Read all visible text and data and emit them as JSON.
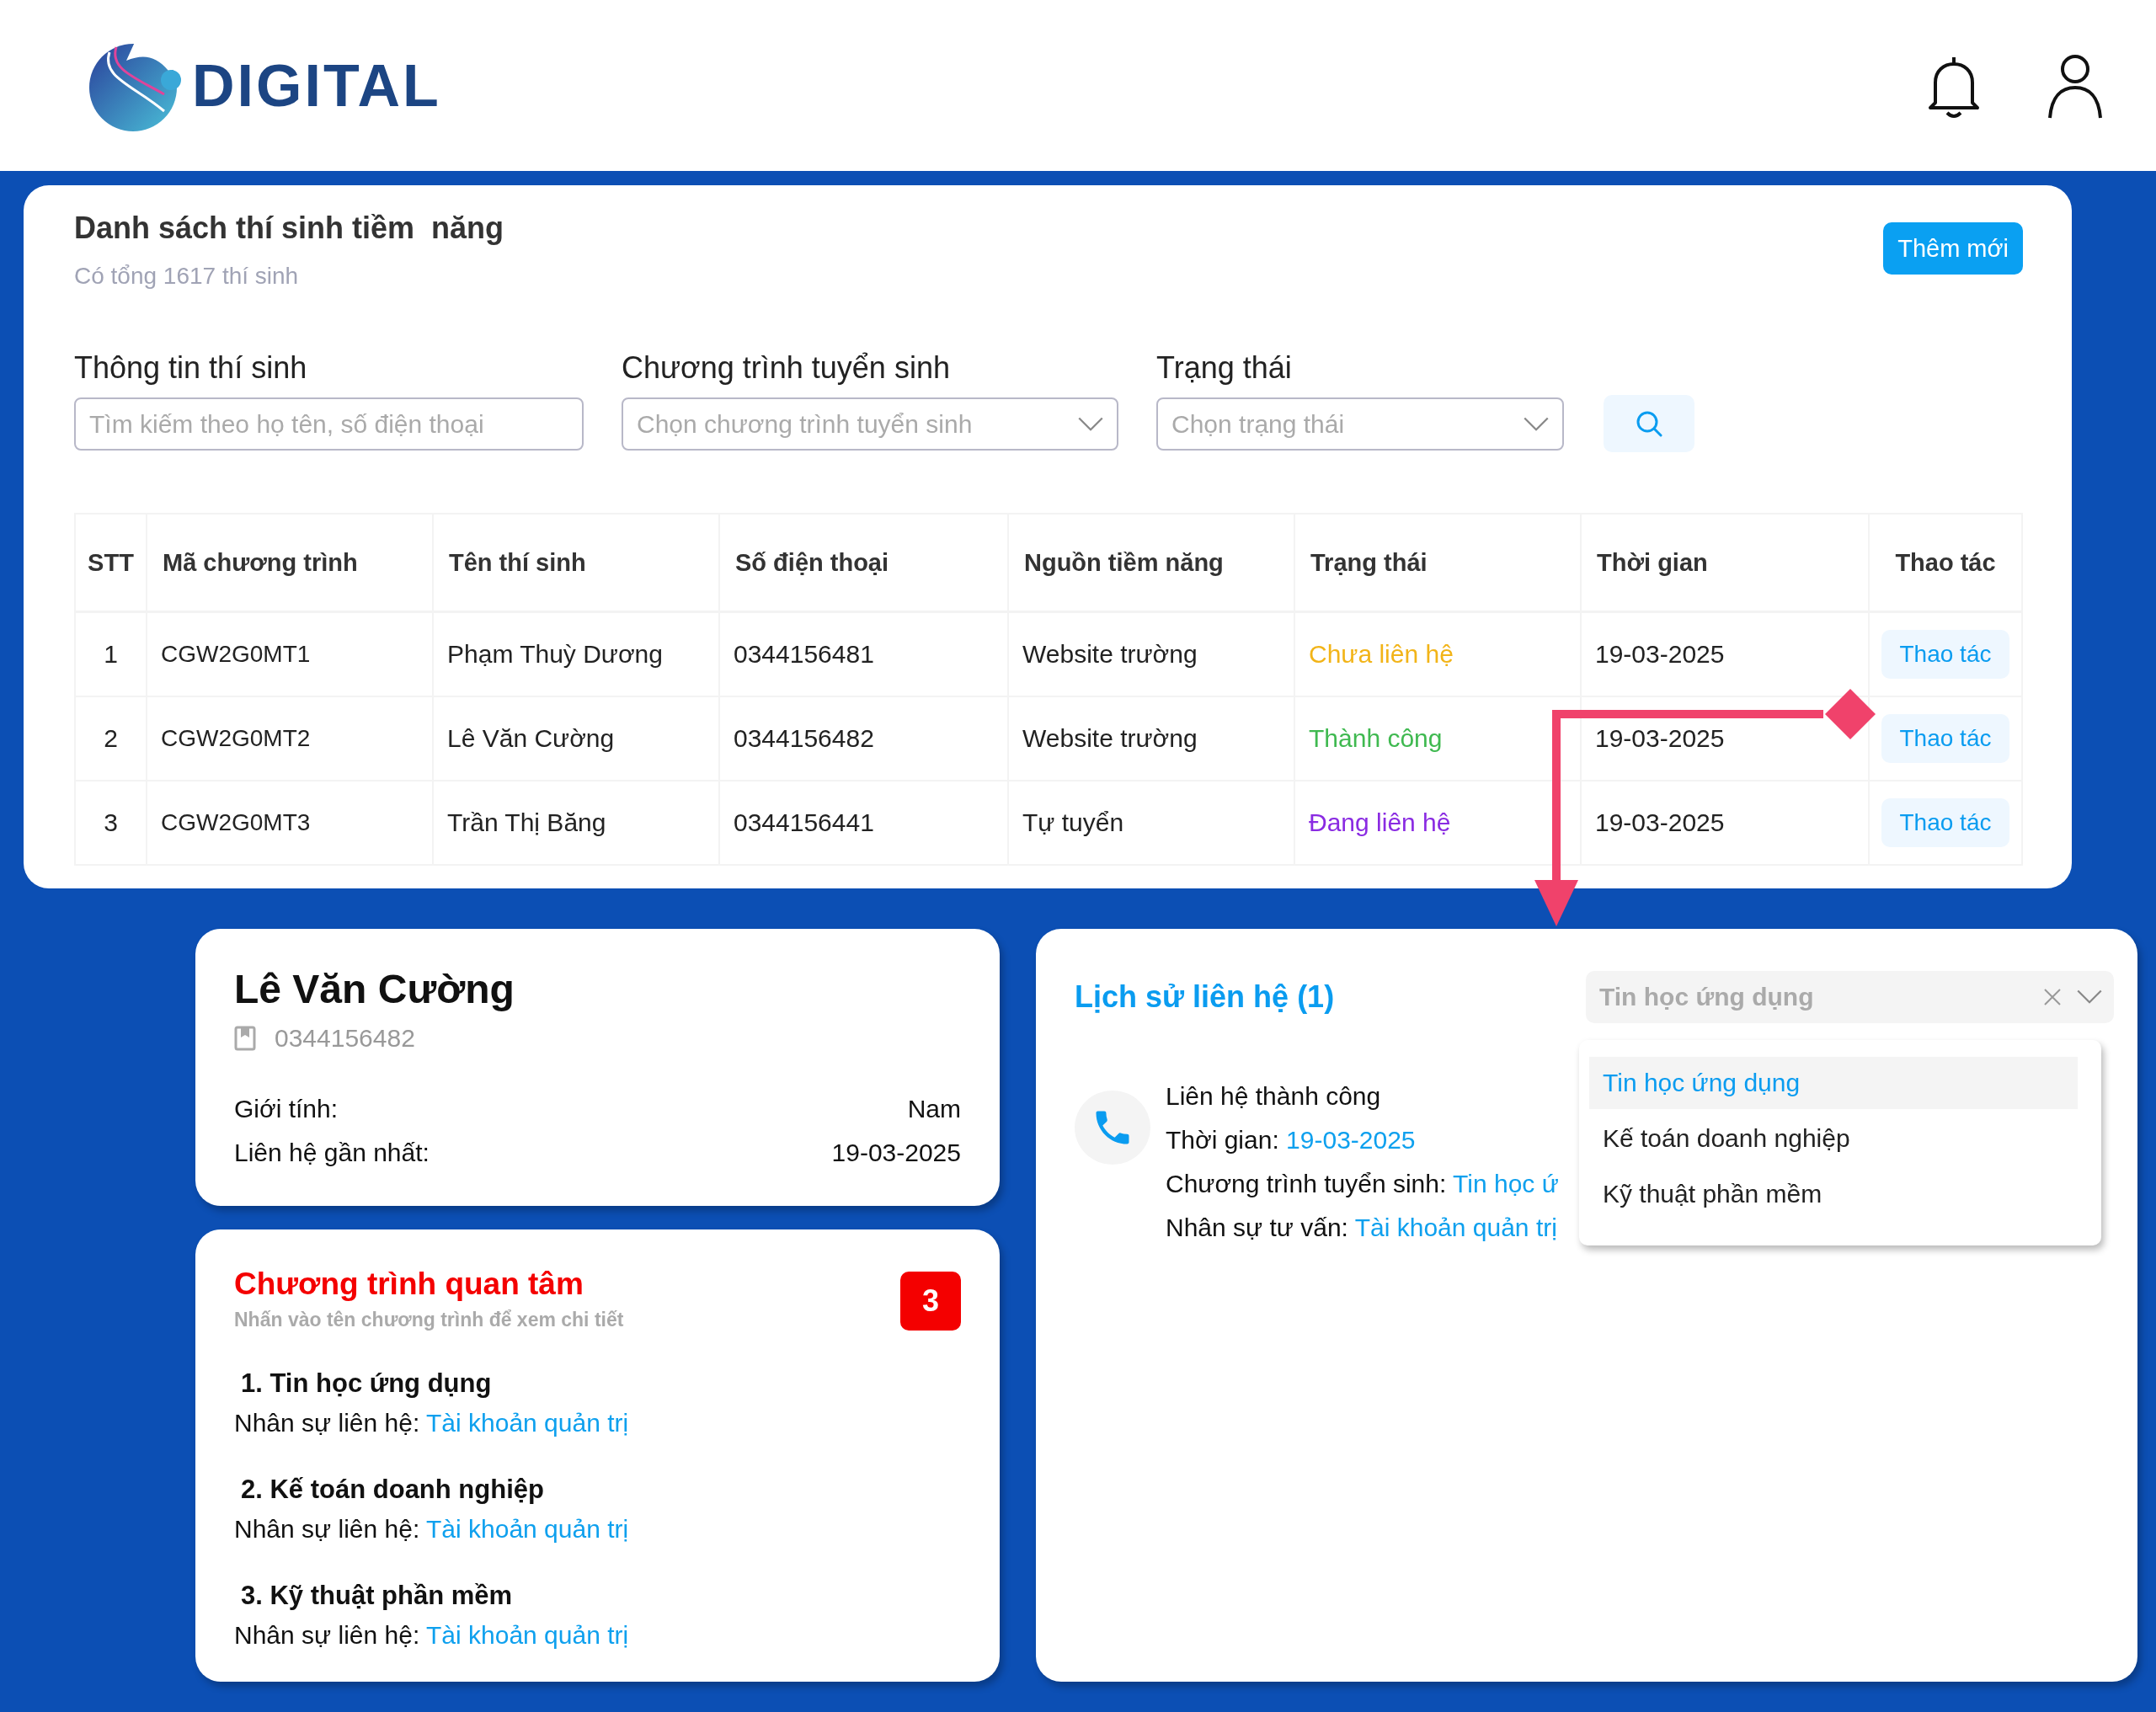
{
  "header": {
    "logo_text": "DIGITAL"
  },
  "list_card": {
    "title": "Danh sách thí sinh tiềm  năng",
    "subtitle": "Có tổng 1617 thí sinh",
    "add_button": "Thêm mới"
  },
  "filters": [
    {
      "kind": "text",
      "label": "Thông tin thí sinh",
      "placeholder": "Tìm kiếm theo họ tên, số điện thoại"
    },
    {
      "kind": "select",
      "label": "Chương trình tuyển sinh",
      "placeholder": "Chọn chương trình tuyển sinh"
    },
    {
      "kind": "select",
      "label": "Trạng thái",
      "placeholder": "Chọn trạng thái"
    }
  ],
  "table": {
    "columns": [
      "STT",
      "Mã chương trình",
      "Tên thí sinh",
      "Số điện thoại",
      "Nguồn tiềm năng",
      "Trạng thái",
      "Thời gian",
      "Thao tác"
    ],
    "rows": [
      {
        "stt": "1",
        "code": "CGW2G0MT1",
        "name": "Phạm Thuỳ Dương",
        "phone": "0344156481",
        "source": "Website trường",
        "status": {
          "label": "Chưa liên hệ",
          "color": "#f2b418"
        },
        "time": "19-03-2025",
        "action": "Thao tác"
      },
      {
        "stt": "2",
        "code": "CGW2G0MT2",
        "name": "Lê Văn Cường",
        "phone": "0344156482",
        "source": "Website trường",
        "status": {
          "label": "Thành công",
          "color": "#3fb950"
        },
        "time": "19-03-2025",
        "action": "Thao tác"
      },
      {
        "stt": "3",
        "code": "CGW2G0MT3",
        "name": "Trần Thị Băng",
        "phone": "0344156441",
        "source": "Tự tuyển",
        "status": {
          "label": "Đang liên hệ",
          "color": "#8a2be2"
        },
        "time": "19-03-2025",
        "action": "Thao tác"
      }
    ]
  },
  "candidate": {
    "name": "Lê Văn Cường",
    "phone": "0344156482",
    "fields": [
      {
        "label": "Giới tính:",
        "value": "Nam"
      },
      {
        "label": "Liên hệ gần nhất:",
        "value": "19-03-2025"
      }
    ]
  },
  "interests": {
    "title": "Chương trình quan tâm",
    "hint": "Nhấn vào tên chương trình để xem chi tiết",
    "count": "3",
    "items": [
      {
        "title": "1. Tin học ứng dụng",
        "contact_label": "Nhân sự liên hệ:",
        "contact": "Tài khoản quản trị"
      },
      {
        "title": "2. Kế toán doanh nghiệp",
        "contact_label": "Nhân sự liên hệ:",
        "contact": "Tài khoản quản trị"
      },
      {
        "title": "3. Kỹ thuật phần mềm",
        "contact_label": "Nhân sự liên hệ:",
        "contact": "Tài khoản quản trị"
      }
    ]
  },
  "history": {
    "title": "Lịch sử liên hệ (1)",
    "filter": {
      "placeholder": "Tin học ứng dụng"
    },
    "entries": [
      {
        "title": "Liên hệ thành công",
        "lines": [
          {
            "label": "Thời gian:",
            "value": "19-03-2025"
          },
          {
            "label": "Chương trình tuyển sinh:",
            "value": "Tin học ứ"
          },
          {
            "label": "Nhân sự tư vấn:",
            "value": "Tài khoản quản trị"
          }
        ]
      }
    ],
    "dropdown": [
      {
        "label": "Tin học ứng dụng",
        "selected": true
      },
      {
        "label": "Kế toán doanh nghiệp",
        "selected": false
      },
      {
        "label": "Kỹ thuật phần mềm",
        "selected": false
      }
    ]
  }
}
